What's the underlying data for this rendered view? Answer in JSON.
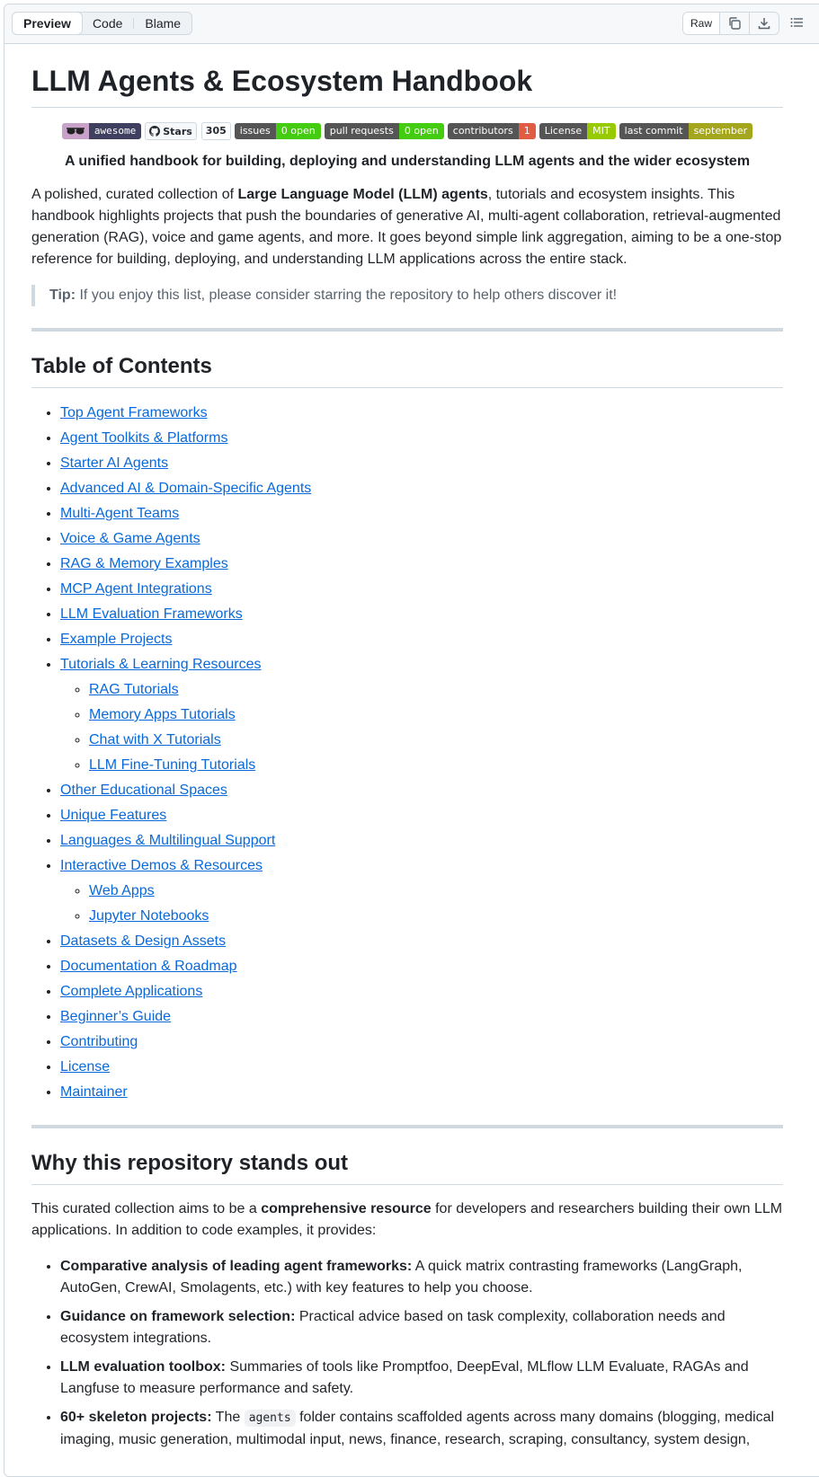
{
  "toolbar": {
    "tabs": [
      "Preview",
      "Code",
      "Blame"
    ],
    "raw_label": "Raw",
    "icons": [
      "copy-icon",
      "download-icon",
      "outline-icon"
    ]
  },
  "title": "LLM Agents & Ecosystem Handbook",
  "badges": {
    "awesome": "awesome",
    "stars_label": "Stars",
    "stars_count": "305",
    "items": [
      {
        "label": "issues",
        "value": "0 open",
        "color": "#4c1"
      },
      {
        "label": "pull requests",
        "value": "0 open",
        "color": "#4c1"
      },
      {
        "label": "contributors",
        "value": "1",
        "color": "#e05d44"
      },
      {
        "label": "License",
        "value": "MIT",
        "color": "#97ca00"
      },
      {
        "label": "last commit",
        "value": "september",
        "color": "#a4a61d"
      }
    ]
  },
  "tagline": "A unified handbook for building, deploying and understanding LLM agents and the wider ecosystem",
  "intro": {
    "pre": "A polished, curated collection of ",
    "bold": "Large Language Model (LLM) agents",
    "post": ", tutorials and ecosystem insights. This handbook highlights projects that push the boundaries of generative AI, multi-agent collaboration, retrieval-augmented generation (RAG), voice and game agents, and more. It goes beyond simple link aggregation, aiming to be a one-stop reference for building, deploying, and understanding LLM applications across the entire stack."
  },
  "tip": {
    "label": "Tip:",
    "text": " If you enjoy this list, please consider starring the repository to help others discover it!"
  },
  "toc": {
    "heading": "Table of Contents",
    "items": [
      {
        "label": "Top Agent Frameworks"
      },
      {
        "label": "Agent Toolkits & Platforms"
      },
      {
        "label": "Starter AI Agents"
      },
      {
        "label": "Advanced AI & Domain-Specific Agents"
      },
      {
        "label": "Multi-Agent Teams"
      },
      {
        "label": "Voice & Game Agents"
      },
      {
        "label": "RAG & Memory Examples"
      },
      {
        "label": "MCP Agent Integrations"
      },
      {
        "label": "LLM Evaluation Frameworks"
      },
      {
        "label": "Example Projects"
      },
      {
        "label": "Tutorials & Learning Resources",
        "children": [
          "RAG Tutorials",
          "Memory Apps Tutorials",
          "Chat with X Tutorials",
          "LLM Fine-Tuning Tutorials"
        ]
      },
      {
        "label": "Other Educational Spaces"
      },
      {
        "label": "Unique Features"
      },
      {
        "label": "Languages & Multilingual Support"
      },
      {
        "label": "Interactive Demos & Resources",
        "children": [
          "Web Apps",
          "Jupyter Notebooks"
        ]
      },
      {
        "label": "Datasets & Design Assets"
      },
      {
        "label": "Documentation & Roadmap"
      },
      {
        "label": "Complete Applications"
      },
      {
        "label": "Beginner’s Guide"
      },
      {
        "label": "Contributing"
      },
      {
        "label": "License"
      },
      {
        "label": "Maintainer"
      }
    ]
  },
  "why": {
    "heading": "Why this repository stands out",
    "intro_pre": "This curated collection aims to be a ",
    "intro_bold": "comprehensive resource",
    "intro_post": " for developers and researchers building their own LLM applications. In addition to code examples, it provides:",
    "items": [
      {
        "bold": "Comparative analysis of leading agent frameworks:",
        "text": " A quick matrix contrasting frameworks (LangGraph, AutoGen, CrewAI, Smolagents, etc.) with key features to help you choose."
      },
      {
        "bold": "Guidance on framework selection:",
        "text": " Practical advice based on task complexity, collaboration needs and ecosystem integrations."
      },
      {
        "bold": "LLM evaluation toolbox:",
        "text": " Summaries of tools like Promptfoo, DeepEval, MLflow LLM Evaluate, RAGAs and Langfuse to measure performance and safety."
      },
      {
        "bold": "60+ skeleton projects:",
        "text_pre": " The ",
        "code": "agents",
        "text": " folder contains scaffolded agents across many domains (blogging, medical imaging, music generation, multimodal input, news, finance, research, scraping, consultancy, system design,"
      }
    ]
  }
}
